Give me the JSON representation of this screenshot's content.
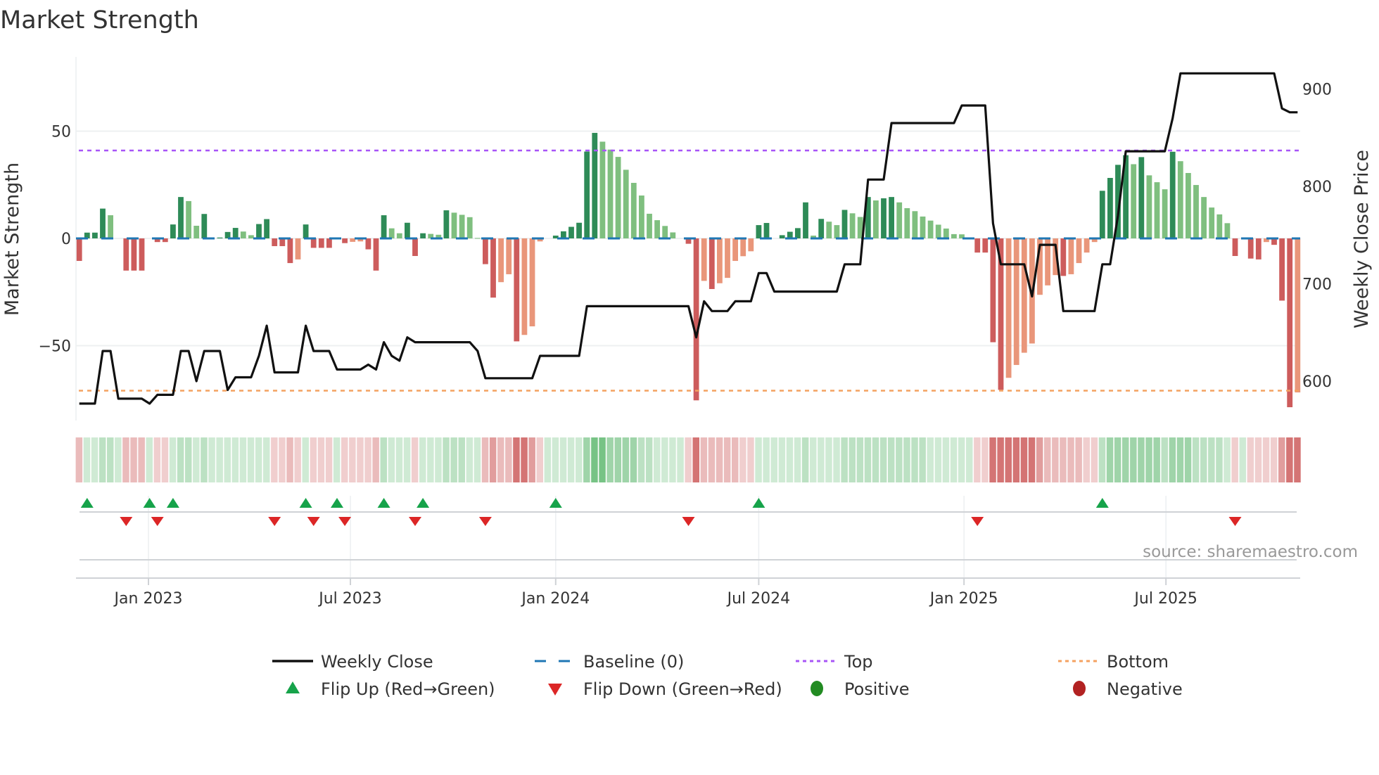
{
  "title": "Market Strength",
  "source": "source: sharemaestro.com",
  "colors": {
    "pos_dark": "#2e8b57",
    "pos_light": "#7fbf7f",
    "neg_dark": "#cd5c5c",
    "neg_light": "#e9967a",
    "close": "#111111",
    "baseline": "#1f77b4",
    "top": "#a855f7",
    "bottom": "#f4a261",
    "flip_up": "#16a34a",
    "flip_down": "#dc2626",
    "positive": "#228b22",
    "negative": "#b22222"
  },
  "chart_data": {
    "type": "bar",
    "title": "Market Strength",
    "ylabel": "Market Strength",
    "y2label": "Weekly Close Price",
    "ylim": [
      -85,
      88
    ],
    "y2lim": [
      559,
      935
    ],
    "yticks": [
      50,
      0,
      -50
    ],
    "ytick_labels": [
      "50",
      "0",
      "−50"
    ],
    "y2ticks": [
      900,
      800,
      700,
      600
    ],
    "y2tick_labels": [
      "900",
      "800",
      "700",
      "600"
    ],
    "x_start": "2022-10-31",
    "x_step_days": 7,
    "xticks": [
      "2023-01-01",
      "2023-07-01",
      "2024-01-01",
      "2024-07-01",
      "2025-01-01",
      "2025-07-01"
    ],
    "xtick_labels": [
      "Jan 2023",
      "Jul 2023",
      "Jan 2024",
      "Jul 2024",
      "Jan 2025",
      "Jul 2025"
    ],
    "top_level": 41,
    "bottom_level": -71,
    "baseline": 0,
    "strength": [
      -10.5,
      2.7,
      2.7,
      13.9,
      10.8,
      0,
      -15,
      -15,
      -15,
      0,
      -1.7,
      -1.7,
      6.5,
      19.3,
      17.4,
      5.9,
      11.4,
      0,
      0.4,
      3,
      4.9,
      3.2,
      1.5,
      6.7,
      9,
      -3.6,
      -3.6,
      -11.5,
      -9.8,
      6.5,
      -4.4,
      -4.4,
      -4.4,
      0,
      -2.2,
      -1.6,
      -1.4,
      -5.1,
      -15,
      10.8,
      4.7,
      2.4,
      7.3,
      -8.2,
      2.4,
      2.1,
      1.7,
      13.1,
      12,
      11,
      9.9,
      0.2,
      -12,
      -27.6,
      -20.4,
      -16.7,
      -48,
      -45,
      -41,
      -1.4,
      0,
      1.3,
      3.3,
      5.4,
      7.3,
      40.5,
      49.2,
      45.1,
      41.4,
      38,
      32,
      25.9,
      20,
      11.5,
      8.5,
      5.8,
      2.8,
      0,
      -2.5,
      -75.5,
      -19.8,
      -23.6,
      -20.9,
      -18.4,
      -10.5,
      -8.3,
      -6,
      6.2,
      7.2,
      0,
      1.5,
      3.1,
      4.8,
      16.8,
      1.3,
      9.1,
      7.8,
      6.2,
      13.3,
      11.7,
      10,
      19.3,
      17.7,
      18.7,
      19.3,
      16.8,
      14.1,
      12.7,
      10.2,
      8.3,
      6.4,
      4.6,
      2,
      1.9,
      0,
      -6.6,
      -6.6,
      -48.4,
      -70.6,
      -65,
      -59,
      -53.3,
      -49,
      -26.3,
      -21.9,
      -17.1,
      -17.5,
      -16.7,
      -11.5,
      -6.6,
      -1.7,
      22.2,
      28.2,
      34.3,
      38.8,
      34.6,
      37.9,
      29.4,
      26.2,
      22.9,
      40.4,
      36,
      30.5,
      24.9,
      19.3,
      14.4,
      11.2,
      7.1,
      -8.2,
      0,
      -9.4,
      -9.8,
      -1.7,
      -3,
      -29,
      -78.7,
      -71.8
    ],
    "weekly_close": [
      577,
      577,
      577,
      631,
      631,
      582,
      582,
      582,
      582,
      577,
      586,
      586,
      586,
      631,
      631,
      600,
      631,
      631,
      631,
      591,
      604,
      604,
      604,
      626,
      657,
      609,
      609,
      609,
      609,
      657,
      631,
      631,
      631,
      612,
      612,
      612,
      612,
      617,
      612,
      640,
      626,
      621,
      645,
      640,
      640,
      640,
      640,
      640,
      640,
      640,
      640,
      631,
      603,
      603,
      603,
      603,
      603,
      603,
      603,
      626,
      626,
      626,
      626,
      626,
      626,
      677,
      677,
      677,
      677,
      677,
      677,
      677,
      677,
      677,
      677,
      677,
      677,
      677,
      677,
      645,
      682,
      672,
      672,
      672,
      682,
      682,
      682,
      711,
      711,
      692,
      692,
      692,
      692,
      692,
      692,
      692,
      692,
      692,
      720,
      720,
      720,
      807,
      807,
      807,
      865,
      865,
      865,
      865,
      865,
      865,
      865,
      865,
      865,
      883,
      883,
      883,
      883,
      762,
      720,
      720,
      720,
      720,
      687,
      740,
      740,
      740,
      672,
      672,
      672,
      672,
      672,
      720,
      720,
      770,
      836,
      836,
      836,
      836,
      836,
      836,
      870,
      916,
      916,
      916,
      916,
      916,
      916,
      916,
      916,
      916,
      916,
      916,
      916,
      916,
      880,
      876,
      876
    ],
    "flip_up_weeks": [
      1,
      9,
      12,
      29,
      33,
      39,
      44,
      61,
      87,
      131
    ],
    "flip_down_weeks": [
      6,
      10,
      25,
      30,
      34,
      43,
      52,
      78,
      115,
      148
    ],
    "legend": [
      {
        "label": "Weekly Close",
        "kind": "line"
      },
      {
        "label": "Baseline (0)",
        "kind": "dash"
      },
      {
        "label": "Top",
        "kind": "dot-top"
      },
      {
        "label": "Bottom",
        "kind": "dot-bottom"
      },
      {
        "label": "Flip Up (Red→Green)",
        "kind": "tri-up"
      },
      {
        "label": "Flip Down (Green→Red)",
        "kind": "tri-down"
      },
      {
        "label": "Positive",
        "kind": "dot-pos"
      },
      {
        "label": "Negative",
        "kind": "dot-neg"
      }
    ],
    "legend_position": "bottom"
  }
}
